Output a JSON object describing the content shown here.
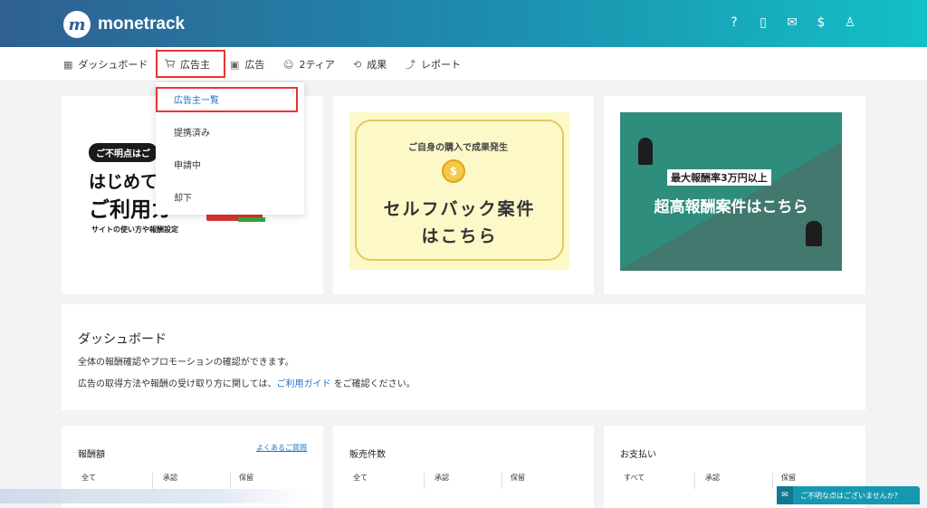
{
  "header": {
    "logo_mark": "m",
    "logo_text": "monetrack",
    "icons": [
      "help-icon",
      "book-icon",
      "mail-icon",
      "dollar-icon",
      "user-icon"
    ],
    "icon_glyphs": [
      "?",
      "▯",
      "✉",
      "$",
      "♙"
    ]
  },
  "nav": {
    "items": [
      {
        "label": "ダッシュボード",
        "icon": "▦"
      },
      {
        "label": "広告主",
        "icon": "🛒"
      },
      {
        "label": "広告",
        "icon": "▣"
      },
      {
        "label": "2ティア",
        "icon": "☺"
      },
      {
        "label": "成果",
        "icon": "⟲"
      },
      {
        "label": "レポート",
        "icon": "⤴"
      }
    ]
  },
  "dropdown": {
    "items": [
      "広告主一覧",
      "提携済み",
      "申請中",
      "却下"
    ]
  },
  "banners": {
    "b1": {
      "badge": "ご不明点はご",
      "line1": "はじめての",
      "line2": "ご利用ガ",
      "sub": "サイトの使い方や報酬設定"
    },
    "b2": {
      "arc": "ご自身の購入で成果発生",
      "coin": "$",
      "main1": "セルフバック案件",
      "main2": "はこちら"
    },
    "b3": {
      "badge": "最大報酬率3万円以上",
      "main": "超高報酬案件はこちら"
    }
  },
  "dashboard": {
    "title": "ダッシュボード",
    "line1": "全体の報酬確認やプロモーションの確認ができます。",
    "line2_pre": "広告の取得方法や報酬の受け取り方に関しては、",
    "line2_link": "ご利用ガイド",
    "line2_post": "をご確認ください。"
  },
  "stats": [
    {
      "title": "報酬額",
      "link": "よくあるご質問",
      "cols": [
        "全て",
        "承認",
        "保留"
      ]
    },
    {
      "title": "販売件数",
      "link": "",
      "cols": [
        "全て",
        "承認",
        "保留"
      ]
    },
    {
      "title": "お支払い",
      "link": "",
      "cols": [
        "すべて",
        "承認",
        "保留"
      ]
    }
  ],
  "help": {
    "icon": "✉",
    "label": "ご不明な点はございませんか？"
  },
  "colors": {
    "accent": "#1a73c8",
    "highlight": "#e33333",
    "header_start": "#2f5f93",
    "header_end": "#13c0c8"
  }
}
